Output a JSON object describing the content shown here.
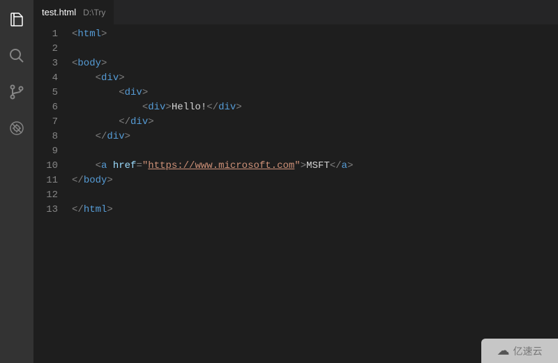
{
  "tab": {
    "filename": "test.html",
    "path": "D:\\Try"
  },
  "activity": {
    "files": "Explorer",
    "search": "Search",
    "scm": "Source Control",
    "debug": "Debug"
  },
  "gutter": [
    "1",
    "2",
    "3",
    "4",
    "5",
    "6",
    "7",
    "8",
    "9",
    "10",
    "11",
    "12",
    "13"
  ],
  "code": {
    "l1": {
      "i": "",
      "open": "<",
      "tag": "html",
      "close": ">"
    },
    "l2": {
      "i": ""
    },
    "l3": {
      "i": "",
      "open": "<",
      "tag": "body",
      "close": ">"
    },
    "l4": {
      "i": "    ",
      "open": "<",
      "tag": "div",
      "close": ">"
    },
    "l5": {
      "i": "        ",
      "open": "<",
      "tag": "div",
      "close": ">"
    },
    "l6": {
      "i": "            ",
      "open": "<",
      "tag": "div",
      "close1": ">",
      "text": "Hello!",
      "open2": "</",
      "tag2": "div",
      "close2": ">"
    },
    "l7": {
      "i": "        ",
      "open": "</",
      "tag": "div",
      "close": ">"
    },
    "l8": {
      "i": "    ",
      "open": "</",
      "tag": "div",
      "close": ">"
    },
    "l9": {
      "i": ""
    },
    "l10": {
      "i": "    ",
      "open": "<",
      "tag": "a",
      "sp": " ",
      "attr": "href",
      "eq": "=",
      "q1": "\"",
      "url": "https://www.microsoft.com",
      "q2": "\"",
      "close1": ">",
      "text": "MSFT",
      "open2": "</",
      "tag2": "a",
      "close2": ">"
    },
    "l11": {
      "i": "",
      "open": "</",
      "tag": "body",
      "close": ">"
    },
    "l12": {
      "i": ""
    },
    "l13": {
      "i": "",
      "open": "</",
      "tag": "html",
      "close": ">"
    }
  },
  "watermark": {
    "text": "亿速云"
  }
}
